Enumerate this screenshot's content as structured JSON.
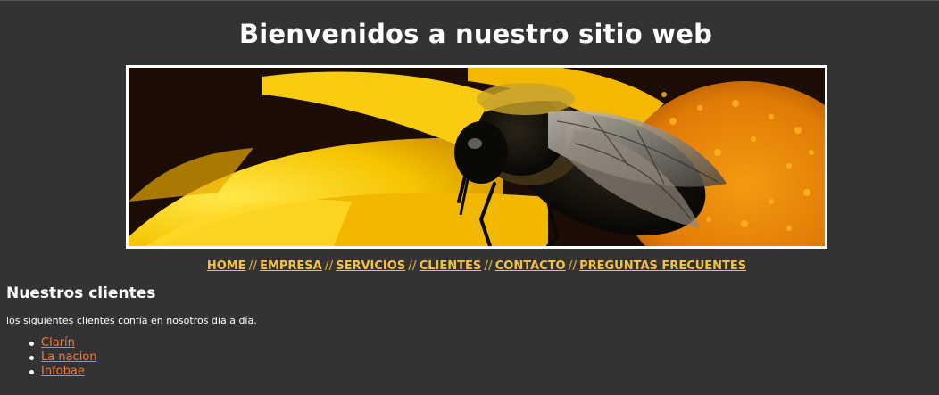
{
  "header": {
    "title": "Bienvenidos a nuestro sitio web"
  },
  "banner": {
    "subject": "bee-on-yellow-flower"
  },
  "nav": {
    "separator": "//",
    "items": [
      {
        "label": "HOME"
      },
      {
        "label": "EMPRESA"
      },
      {
        "label": "SERVICIOS"
      },
      {
        "label": "CLIENTES"
      },
      {
        "label": "CONTACTO"
      },
      {
        "label": "PREGUNTAS FRECUENTES"
      }
    ]
  },
  "main": {
    "heading": "Nuestros clientes",
    "intro": "los siguientes clientes confía en nosotros día a día.",
    "clients": [
      {
        "label": "Clarín"
      },
      {
        "label": "La nacion"
      },
      {
        "label": "Infobae"
      }
    ]
  },
  "colors": {
    "background": "#333333",
    "nav_link": "#f3c14b",
    "client_link": "#f07a3c",
    "banner_border": "#ffffff"
  }
}
